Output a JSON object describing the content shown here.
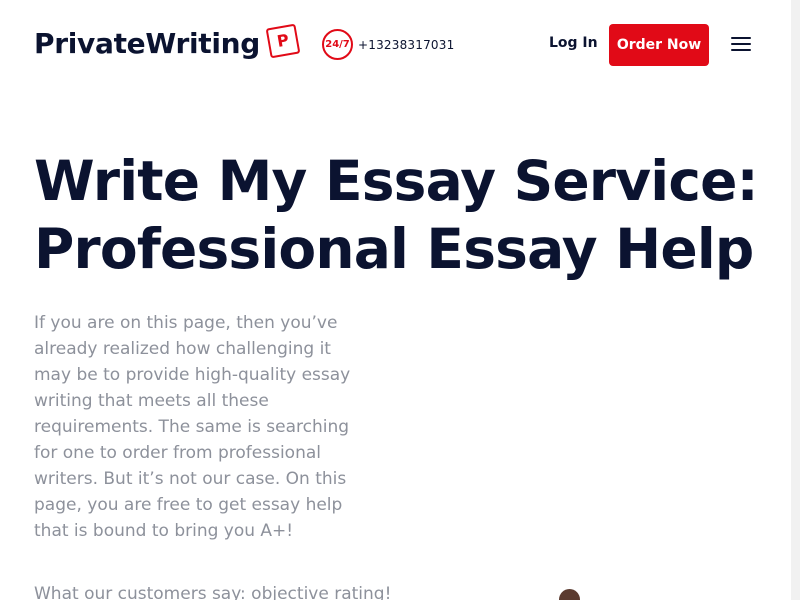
{
  "header": {
    "brand_name": "PrivateWriting",
    "brand_mark": "P",
    "support_badge": "24/7",
    "phone": "+13238317031",
    "login_label": "Log In",
    "order_label": "Order Now",
    "menu_icon": "hamburger-menu-icon"
  },
  "hero": {
    "title": "Write My Essay Service:\nProfessional Essay Help",
    "body": "If you are on this page, then you’ve already realized how challenging it may be to provide high-quality essay writing that meets all these requirements. The same is searching for one to order from professional writers. But it’s not our case. On this page, you are free to get essay help that is bound to bring you A+!",
    "reviews_teaser": "What our customers say: objective rating!"
  },
  "colors": {
    "accent": "#e10a17",
    "text_dark": "#0b1330",
    "text_muted": "#8d919b",
    "background": "#ffffff"
  }
}
